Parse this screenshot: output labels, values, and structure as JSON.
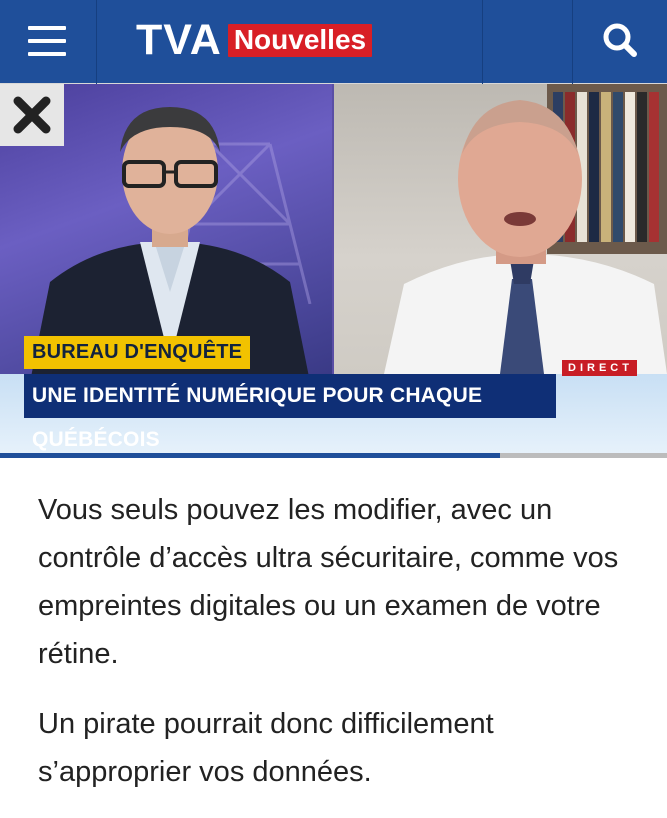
{
  "header": {
    "logo_main": "TVA",
    "logo_badge": "Nouvelles",
    "menu_icon": "hamburger-menu-icon",
    "search_icon": "search-icon",
    "bg_color": "#1f4f9a",
    "badge_color": "#d81f26"
  },
  "video": {
    "close_icon": "close-icon",
    "lower_third_tag": "BUREAU D'ENQUÊTE",
    "lower_third_headline": "UNE IDENTITÉ NUMÉRIQUE POUR CHAQUE QUÉBÉCOIS",
    "live_badge": "DIRECT",
    "progress": 0.75
  },
  "article": {
    "paragraphs": [
      "Vous seuls pouvez les modifier, avec un contrôle d’accès ultra sécuritaire, comme vos empreintes digitales ou un examen de votre rétine.",
      "Un pirate pourrait donc difficilement s’approprier vos données."
    ]
  }
}
